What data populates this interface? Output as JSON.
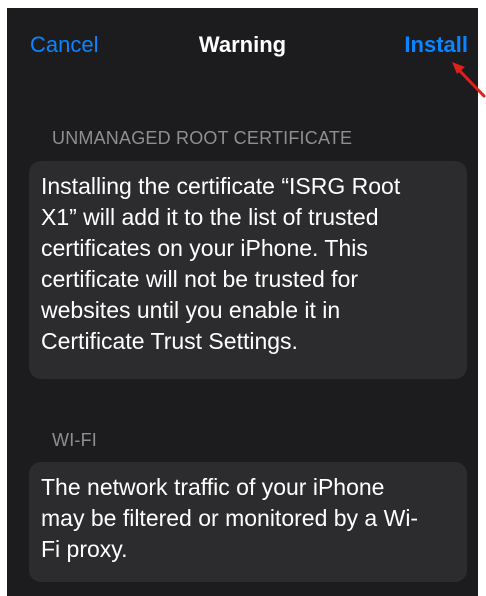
{
  "navbar": {
    "cancel_label": "Cancel",
    "title": "Warning",
    "install_label": "Install"
  },
  "sections": [
    {
      "header": "UNMANAGED ROOT CERTIFICATE",
      "lines": [
        "Installing the certificate “ISRG Root",
        "X1” will add it to the list of trusted",
        "certificates on your iPhone. This",
        "certificate will not be trusted for",
        "websites until you enable it in",
        "Certificate Trust Settings."
      ]
    },
    {
      "header": "WI-FI",
      "lines": [
        "The network traffic of your iPhone",
        "may be filtered or monitored by a Wi-",
        "Fi proxy."
      ]
    }
  ],
  "colors": {
    "accent": "#0a84ff",
    "background": "#1c1c1e",
    "card": "#2c2c2e",
    "annotation": "#e0201b"
  },
  "icons": {
    "annotation": "red-arrow-icon"
  }
}
